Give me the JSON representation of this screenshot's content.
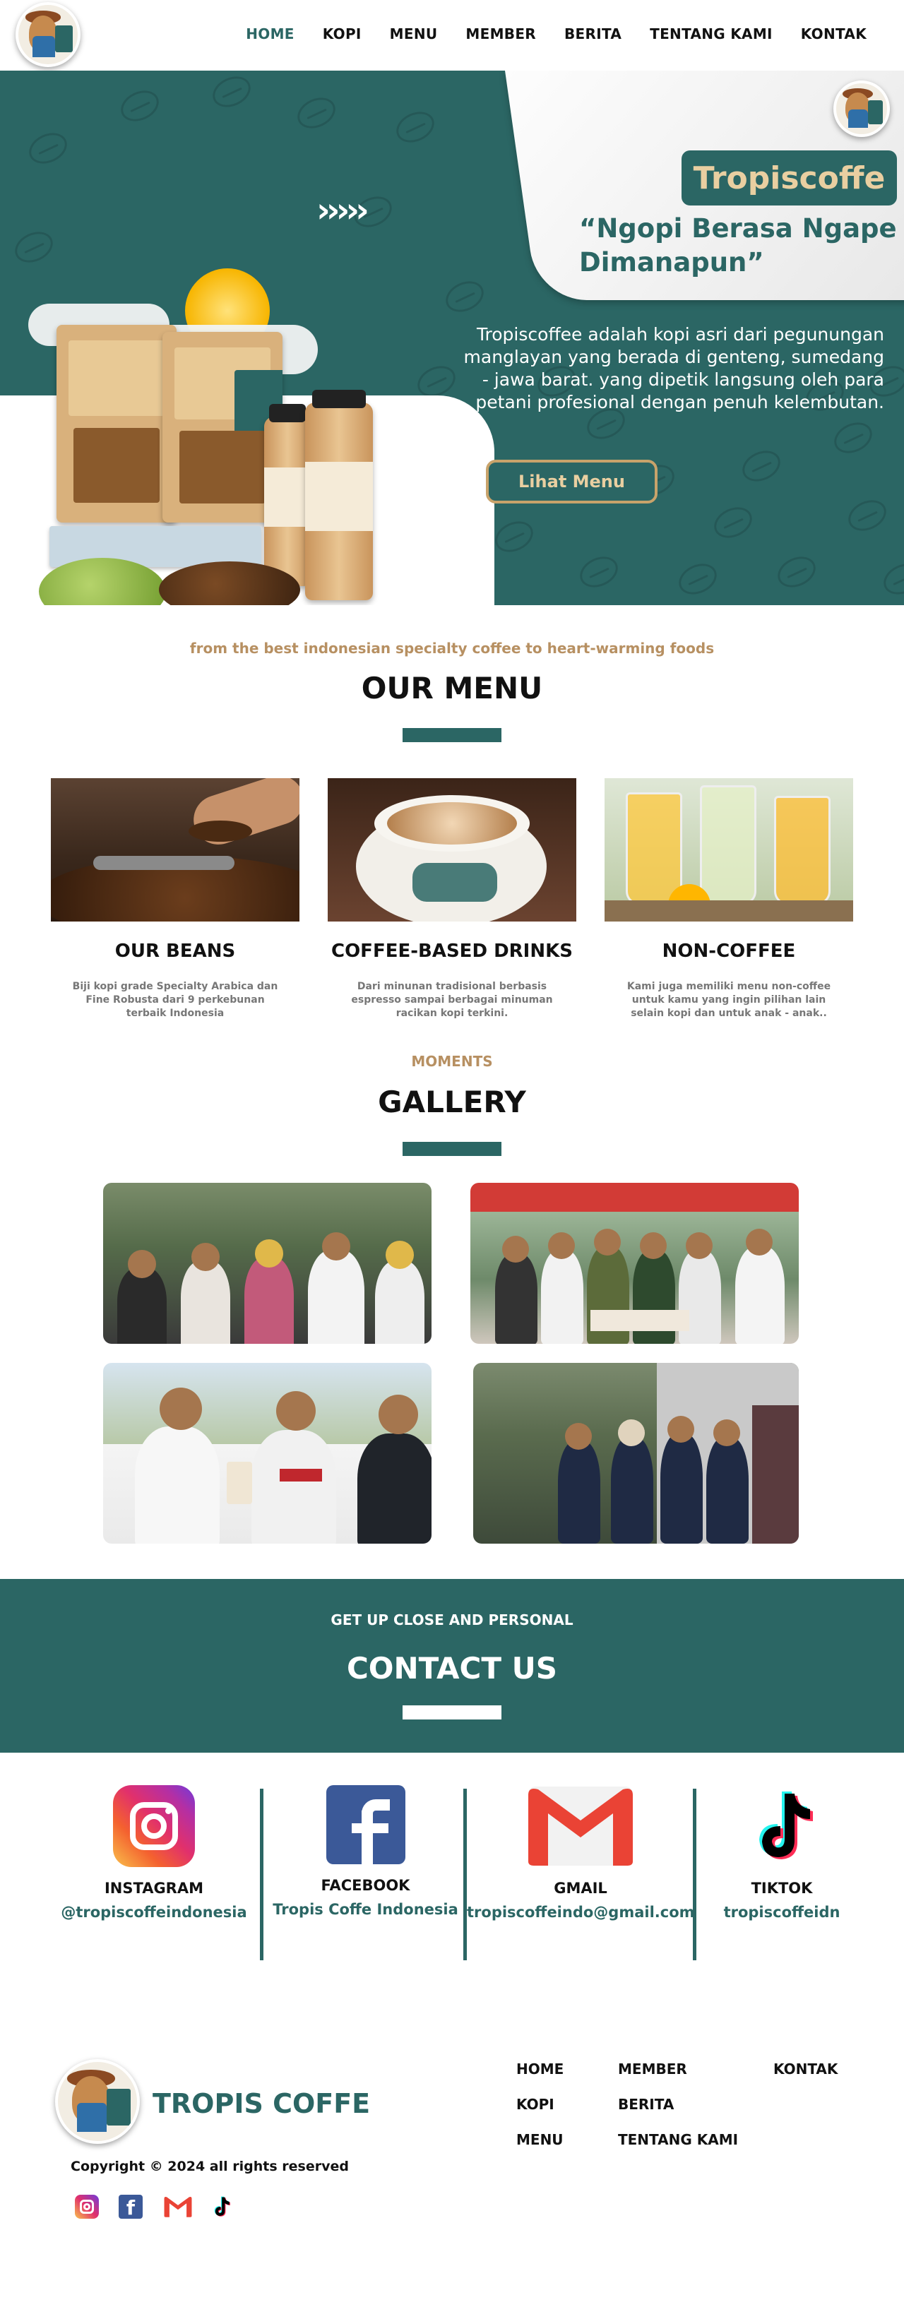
{
  "nav": {
    "items": [
      "HOME",
      "KOPI",
      "MENU",
      "MEMBER",
      "BERITA",
      "TENTANG KAMI",
      "KONTAK"
    ],
    "active": "HOME"
  },
  "hero": {
    "brand": "Tropiscoffe",
    "tagline": "“Ngopi Berasa Ngape Dimanapun”",
    "description": "Tropiscoffee adalah kopi asri dari pegunungan manglayan yang berada di genteng, sumedang - jawa barat. yang dipetik langsung oleh para petani profesional dengan penuh kelembutan.",
    "button": "Lihat Menu"
  },
  "menu": {
    "eyebrow": "from the best indonesian specialty coffee to heart-warming foods",
    "title": "OUR MENU",
    "items": [
      {
        "title": "OUR BEANS",
        "desc": "Biji kopi grade Specialty Arabica dan Fine Robusta dari 9 perkebunan terbaik Indonesia"
      },
      {
        "title": "COFFEE-BASED DRINKS",
        "desc": "Dari minunan tradisional berbasis espresso sampai berbagai minuman racikan kopi terkini."
      },
      {
        "title": "NON-COFFEE",
        "desc": "Kami juga memiliki menu non-coffee untuk kamu yang ingin pilihan lain selain kopi dan untuk anak - anak.."
      }
    ]
  },
  "gallery": {
    "eyebrow": "MOMENTS",
    "title": "GALLERY"
  },
  "contact": {
    "eyebrow": "GET UP CLOSE AND PERSONAL",
    "title": "CONTACT US",
    "channels": [
      {
        "name": "INSTAGRAM",
        "handle": "@tropiscoffeindonesia",
        "icon": "instagram-icon"
      },
      {
        "name": "FACEBOOK",
        "handle": "Tropis Coffe Indonesia",
        "icon": "facebook-icon"
      },
      {
        "name": "GMAIL",
        "handle": "tropiscoffeindo@gmail.com",
        "icon": "gmail-icon"
      },
      {
        "name": "TIKTOK",
        "handle": "tropiscoffeidn",
        "icon": "tiktok-icon"
      }
    ]
  },
  "footer": {
    "brand": "TROPIS COFFE",
    "copyright": "Copyright  © 2024 all rights reserved",
    "links": [
      "HOME",
      "KOPI",
      "MENU",
      "MEMBER",
      "BERITA",
      "TENTANG KAMI",
      "KONTAK"
    ]
  },
  "colors": {
    "primary": "#2b6664",
    "accent_gold": "#c8a36b",
    "eyebrow": "#b79062"
  }
}
